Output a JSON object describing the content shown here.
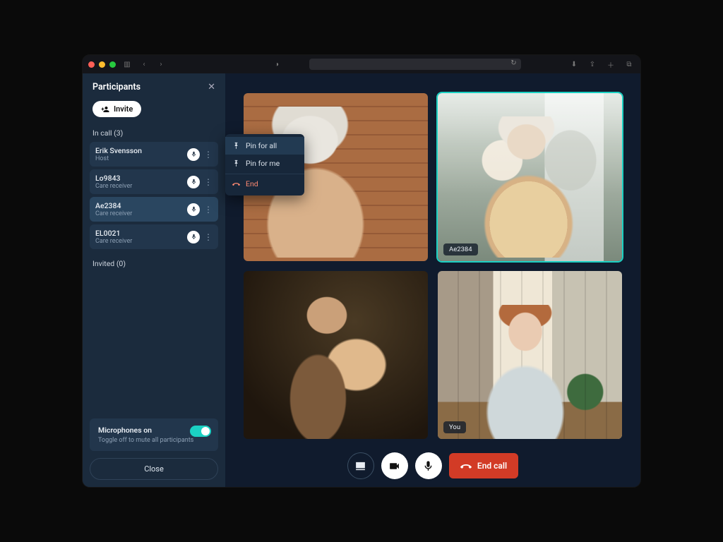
{
  "sidebar": {
    "title": "Participants",
    "invite_label": "Invite",
    "in_call_label": "In call (3)",
    "invited_label": "Invited (0)",
    "participants": [
      {
        "name": "Erik Svensson",
        "role": "Host"
      },
      {
        "name": "Lo9843",
        "role": "Care receiver"
      },
      {
        "name": "Ae2384",
        "role": "Care receiver"
      },
      {
        "name": "EL0021",
        "role": "Care receiver"
      }
    ],
    "mic_toggle": {
      "title": "Microphones on",
      "subtitle": "Toggle off to mute all participants",
      "on": true
    },
    "close_label": "Close"
  },
  "context_menu": {
    "pin_all": "Pin for all",
    "pin_me": "Pin for me",
    "end": "End"
  },
  "tiles": {
    "pinned_label": "Ae2384",
    "you_label": "You"
  },
  "controls": {
    "end_call": "End call"
  }
}
